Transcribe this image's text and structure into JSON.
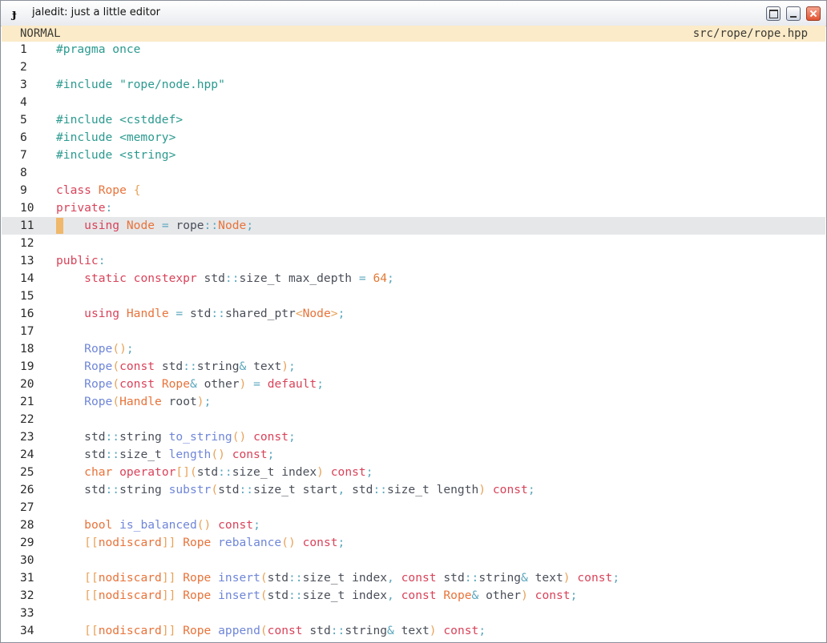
{
  "window": {
    "title": "jaledit: just a little editor",
    "icon": "jaledit-icon"
  },
  "statusbar": {
    "mode": "NORMAL",
    "file_path": "src/rope/rope.hpp"
  },
  "editor": {
    "current_line": 11,
    "lines": [
      {
        "n": "1",
        "tokens": [
          [
            "pre",
            "#pragma once"
          ]
        ]
      },
      {
        "n": "2",
        "tokens": []
      },
      {
        "n": "3",
        "tokens": [
          [
            "pre",
            "#include "
          ],
          [
            "str",
            "\"rope/node.hpp\""
          ]
        ]
      },
      {
        "n": "4",
        "tokens": []
      },
      {
        "n": "5",
        "tokens": [
          [
            "pre",
            "#include <cstddef>"
          ]
        ]
      },
      {
        "n": "6",
        "tokens": [
          [
            "pre",
            "#include <memory>"
          ]
        ]
      },
      {
        "n": "7",
        "tokens": [
          [
            "pre",
            "#include <string>"
          ]
        ]
      },
      {
        "n": "8",
        "tokens": []
      },
      {
        "n": "9",
        "tokens": [
          [
            "kw",
            "class"
          ],
          [
            "tx",
            " "
          ],
          [
            "type",
            "Rope"
          ],
          [
            "tx",
            " "
          ],
          [
            "br",
            "{"
          ]
        ]
      },
      {
        "n": "10",
        "tokens": [
          [
            "kw",
            "private"
          ],
          [
            "op",
            ":"
          ]
        ]
      },
      {
        "n": "11",
        "tokens": [
          [
            "tx",
            "    "
          ],
          [
            "kw",
            "using"
          ],
          [
            "tx",
            " "
          ],
          [
            "type",
            "Node"
          ],
          [
            "tx",
            " "
          ],
          [
            "op",
            "="
          ],
          [
            "tx",
            " "
          ],
          [
            "id",
            "rope"
          ],
          [
            "op",
            "::"
          ],
          [
            "type",
            "Node"
          ],
          [
            "op",
            ";"
          ]
        ]
      },
      {
        "n": "12",
        "tokens": []
      },
      {
        "n": "13",
        "tokens": [
          [
            "kw",
            "public"
          ],
          [
            "op",
            ":"
          ]
        ]
      },
      {
        "n": "14",
        "tokens": [
          [
            "tx",
            "    "
          ],
          [
            "kw",
            "static"
          ],
          [
            "tx",
            " "
          ],
          [
            "kw",
            "constexpr"
          ],
          [
            "tx",
            " "
          ],
          [
            "id",
            "std"
          ],
          [
            "op",
            "::"
          ],
          [
            "id",
            "size_t"
          ],
          [
            "tx",
            " "
          ],
          [
            "id",
            "max_depth"
          ],
          [
            "tx",
            " "
          ],
          [
            "op",
            "="
          ],
          [
            "tx",
            " "
          ],
          [
            "num",
            "64"
          ],
          [
            "op",
            ";"
          ]
        ]
      },
      {
        "n": "15",
        "tokens": []
      },
      {
        "n": "16",
        "tokens": [
          [
            "tx",
            "    "
          ],
          [
            "kw",
            "using"
          ],
          [
            "tx",
            " "
          ],
          [
            "type",
            "Handle"
          ],
          [
            "tx",
            " "
          ],
          [
            "op",
            "="
          ],
          [
            "tx",
            " "
          ],
          [
            "id",
            "std"
          ],
          [
            "op",
            "::"
          ],
          [
            "id",
            "shared_ptr"
          ],
          [
            "br",
            "<"
          ],
          [
            "type",
            "Node"
          ],
          [
            "br",
            ">"
          ],
          [
            "op",
            ";"
          ]
        ]
      },
      {
        "n": "17",
        "tokens": []
      },
      {
        "n": "18",
        "tokens": [
          [
            "tx",
            "    "
          ],
          [
            "fn",
            "Rope"
          ],
          [
            "br",
            "()"
          ],
          [
            "op",
            ";"
          ]
        ]
      },
      {
        "n": "19",
        "tokens": [
          [
            "tx",
            "    "
          ],
          [
            "fn",
            "Rope"
          ],
          [
            "br",
            "("
          ],
          [
            "kw",
            "const"
          ],
          [
            "tx",
            " "
          ],
          [
            "id",
            "std"
          ],
          [
            "op",
            "::"
          ],
          [
            "id",
            "string"
          ],
          [
            "op",
            "&"
          ],
          [
            "tx",
            " "
          ],
          [
            "id",
            "text"
          ],
          [
            "br",
            ")"
          ],
          [
            "op",
            ";"
          ]
        ]
      },
      {
        "n": "20",
        "tokens": [
          [
            "tx",
            "    "
          ],
          [
            "fn",
            "Rope"
          ],
          [
            "br",
            "("
          ],
          [
            "kw",
            "const"
          ],
          [
            "tx",
            " "
          ],
          [
            "type",
            "Rope"
          ],
          [
            "op",
            "&"
          ],
          [
            "tx",
            " "
          ],
          [
            "id",
            "other"
          ],
          [
            "br",
            ")"
          ],
          [
            "tx",
            " "
          ],
          [
            "op",
            "="
          ],
          [
            "tx",
            " "
          ],
          [
            "kw",
            "default"
          ],
          [
            "op",
            ";"
          ]
        ]
      },
      {
        "n": "21",
        "tokens": [
          [
            "tx",
            "    "
          ],
          [
            "fn",
            "Rope"
          ],
          [
            "br",
            "("
          ],
          [
            "type",
            "Handle"
          ],
          [
            "tx",
            " "
          ],
          [
            "id",
            "root"
          ],
          [
            "br",
            ")"
          ],
          [
            "op",
            ";"
          ]
        ]
      },
      {
        "n": "22",
        "tokens": []
      },
      {
        "n": "23",
        "tokens": [
          [
            "tx",
            "    "
          ],
          [
            "id",
            "std"
          ],
          [
            "op",
            "::"
          ],
          [
            "id",
            "string"
          ],
          [
            "tx",
            " "
          ],
          [
            "fn",
            "to_string"
          ],
          [
            "br",
            "()"
          ],
          [
            "tx",
            " "
          ],
          [
            "kw",
            "const"
          ],
          [
            "op",
            ";"
          ]
        ]
      },
      {
        "n": "24",
        "tokens": [
          [
            "tx",
            "    "
          ],
          [
            "id",
            "std"
          ],
          [
            "op",
            "::"
          ],
          [
            "id",
            "size_t"
          ],
          [
            "tx",
            " "
          ],
          [
            "fn",
            "length"
          ],
          [
            "br",
            "()"
          ],
          [
            "tx",
            " "
          ],
          [
            "kw",
            "const"
          ],
          [
            "op",
            ";"
          ]
        ]
      },
      {
        "n": "25",
        "tokens": [
          [
            "tx",
            "    "
          ],
          [
            "type",
            "char"
          ],
          [
            "tx",
            " "
          ],
          [
            "kw",
            "operator"
          ],
          [
            "br",
            "[]("
          ],
          [
            "id",
            "std"
          ],
          [
            "op",
            "::"
          ],
          [
            "id",
            "size_t"
          ],
          [
            "tx",
            " "
          ],
          [
            "id",
            "index"
          ],
          [
            "br",
            ")"
          ],
          [
            "tx",
            " "
          ],
          [
            "kw",
            "const"
          ],
          [
            "op",
            ";"
          ]
        ]
      },
      {
        "n": "26",
        "tokens": [
          [
            "tx",
            "    "
          ],
          [
            "id",
            "std"
          ],
          [
            "op",
            "::"
          ],
          [
            "id",
            "string"
          ],
          [
            "tx",
            " "
          ],
          [
            "fn",
            "substr"
          ],
          [
            "br",
            "("
          ],
          [
            "id",
            "std"
          ],
          [
            "op",
            "::"
          ],
          [
            "id",
            "size_t"
          ],
          [
            "tx",
            " "
          ],
          [
            "id",
            "start"
          ],
          [
            "op",
            ","
          ],
          [
            "tx",
            " "
          ],
          [
            "id",
            "std"
          ],
          [
            "op",
            "::"
          ],
          [
            "id",
            "size_t"
          ],
          [
            "tx",
            " "
          ],
          [
            "id",
            "length"
          ],
          [
            "br",
            ")"
          ],
          [
            "tx",
            " "
          ],
          [
            "kw",
            "const"
          ],
          [
            "op",
            ";"
          ]
        ]
      },
      {
        "n": "27",
        "tokens": []
      },
      {
        "n": "28",
        "tokens": [
          [
            "tx",
            "    "
          ],
          [
            "type",
            "bool"
          ],
          [
            "tx",
            " "
          ],
          [
            "fn",
            "is_balanced"
          ],
          [
            "br",
            "()"
          ],
          [
            "tx",
            " "
          ],
          [
            "kw",
            "const"
          ],
          [
            "op",
            ";"
          ]
        ]
      },
      {
        "n": "29",
        "tokens": [
          [
            "tx",
            "    "
          ],
          [
            "br",
            "[["
          ],
          [
            "type",
            "nodiscard"
          ],
          [
            "br",
            "]]"
          ],
          [
            "tx",
            " "
          ],
          [
            "type",
            "Rope"
          ],
          [
            "tx",
            " "
          ],
          [
            "fn",
            "rebalance"
          ],
          [
            "br",
            "()"
          ],
          [
            "tx",
            " "
          ],
          [
            "kw",
            "const"
          ],
          [
            "op",
            ";"
          ]
        ]
      },
      {
        "n": "30",
        "tokens": []
      },
      {
        "n": "31",
        "tokens": [
          [
            "tx",
            "    "
          ],
          [
            "br",
            "[["
          ],
          [
            "type",
            "nodiscard"
          ],
          [
            "br",
            "]]"
          ],
          [
            "tx",
            " "
          ],
          [
            "type",
            "Rope"
          ],
          [
            "tx",
            " "
          ],
          [
            "fn",
            "insert"
          ],
          [
            "br",
            "("
          ],
          [
            "id",
            "std"
          ],
          [
            "op",
            "::"
          ],
          [
            "id",
            "size_t"
          ],
          [
            "tx",
            " "
          ],
          [
            "id",
            "index"
          ],
          [
            "op",
            ","
          ],
          [
            "tx",
            " "
          ],
          [
            "kw",
            "const"
          ],
          [
            "tx",
            " "
          ],
          [
            "id",
            "std"
          ],
          [
            "op",
            "::"
          ],
          [
            "id",
            "string"
          ],
          [
            "op",
            "&"
          ],
          [
            "tx",
            " "
          ],
          [
            "id",
            "text"
          ],
          [
            "br",
            ")"
          ],
          [
            "tx",
            " "
          ],
          [
            "kw",
            "const"
          ],
          [
            "op",
            ";"
          ]
        ]
      },
      {
        "n": "32",
        "tokens": [
          [
            "tx",
            "    "
          ],
          [
            "br",
            "[["
          ],
          [
            "type",
            "nodiscard"
          ],
          [
            "br",
            "]]"
          ],
          [
            "tx",
            " "
          ],
          [
            "type",
            "Rope"
          ],
          [
            "tx",
            " "
          ],
          [
            "fn",
            "insert"
          ],
          [
            "br",
            "("
          ],
          [
            "id",
            "std"
          ],
          [
            "op",
            "::"
          ],
          [
            "id",
            "size_t"
          ],
          [
            "tx",
            " "
          ],
          [
            "id",
            "index"
          ],
          [
            "op",
            ","
          ],
          [
            "tx",
            " "
          ],
          [
            "kw",
            "const"
          ],
          [
            "tx",
            " "
          ],
          [
            "type",
            "Rope"
          ],
          [
            "op",
            "&"
          ],
          [
            "tx",
            " "
          ],
          [
            "id",
            "other"
          ],
          [
            "br",
            ")"
          ],
          [
            "tx",
            " "
          ],
          [
            "kw",
            "const"
          ],
          [
            "op",
            ";"
          ]
        ]
      },
      {
        "n": "33",
        "tokens": []
      },
      {
        "n": "34",
        "tokens": [
          [
            "tx",
            "    "
          ],
          [
            "br",
            "[["
          ],
          [
            "type",
            "nodiscard"
          ],
          [
            "br",
            "]]"
          ],
          [
            "tx",
            " "
          ],
          [
            "type",
            "Rope"
          ],
          [
            "tx",
            " "
          ],
          [
            "fn",
            "append"
          ],
          [
            "br",
            "("
          ],
          [
            "kw",
            "const"
          ],
          [
            "tx",
            " "
          ],
          [
            "id",
            "std"
          ],
          [
            "op",
            "::"
          ],
          [
            "id",
            "string"
          ],
          [
            "op",
            "&"
          ],
          [
            "tx",
            " "
          ],
          [
            "id",
            "text"
          ],
          [
            "br",
            ")"
          ],
          [
            "tx",
            " "
          ],
          [
            "kw",
            "const"
          ],
          [
            "op",
            ";"
          ]
        ]
      }
    ]
  }
}
